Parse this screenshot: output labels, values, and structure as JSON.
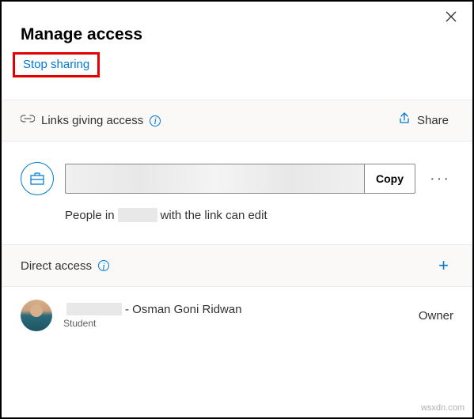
{
  "dialog": {
    "title": "Manage access",
    "stop_sharing": "Stop sharing"
  },
  "links_section": {
    "heading": "Links giving access",
    "share_label": "Share",
    "copy_label": "Copy",
    "desc_prefix": "People in",
    "desc_suffix": "with the link can edit"
  },
  "direct_section": {
    "heading": "Direct access"
  },
  "person": {
    "name_suffix": "- Osman Goni Ridwan",
    "subtitle": "Student",
    "role": "Owner"
  },
  "watermark": "wsxdn.com"
}
